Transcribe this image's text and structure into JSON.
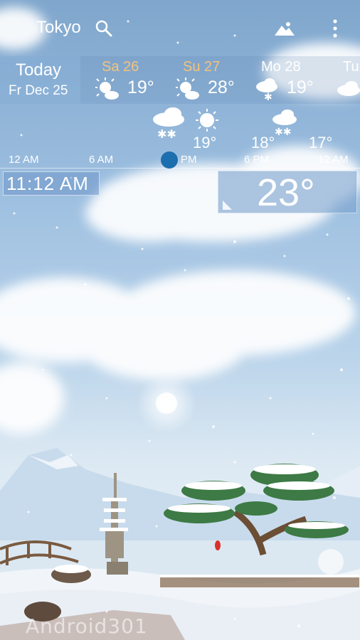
{
  "header": {
    "city": "Tokyo",
    "icons": [
      "search-icon",
      "mountain-icon",
      "more-vert-icon"
    ]
  },
  "days": {
    "today_label": "Today",
    "today_date": "Fr Dec 25",
    "forecast": [
      {
        "day": "Sa 26",
        "temp": "19°",
        "icon": "sun-cloud-icon",
        "weekend": true
      },
      {
        "day": "Su 27",
        "temp": "28°",
        "icon": "sun-cloud-icon",
        "weekend": true
      },
      {
        "day": "Mo 28",
        "temp": "19°",
        "icon": "cloud-snow-icon",
        "weekend": false
      },
      {
        "day": "Tu",
        "temp": "",
        "icon": "cloud-icon",
        "weekend": false
      }
    ]
  },
  "hourly": {
    "temps": [
      "19°",
      "18°",
      "17°"
    ],
    "labels": [
      "12 AM",
      "6 AM",
      "PM",
      "6 PM",
      "12 AM"
    ],
    "icons": [
      "cloud-snow-icon",
      "sun-icon",
      "cloud-snow-icon"
    ]
  },
  "current": {
    "time": "11:12 AM",
    "temperature": "23°"
  },
  "watermark": "Android301",
  "colors": {
    "weekend": "#f3c37b",
    "slider": "#1c6fae"
  }
}
